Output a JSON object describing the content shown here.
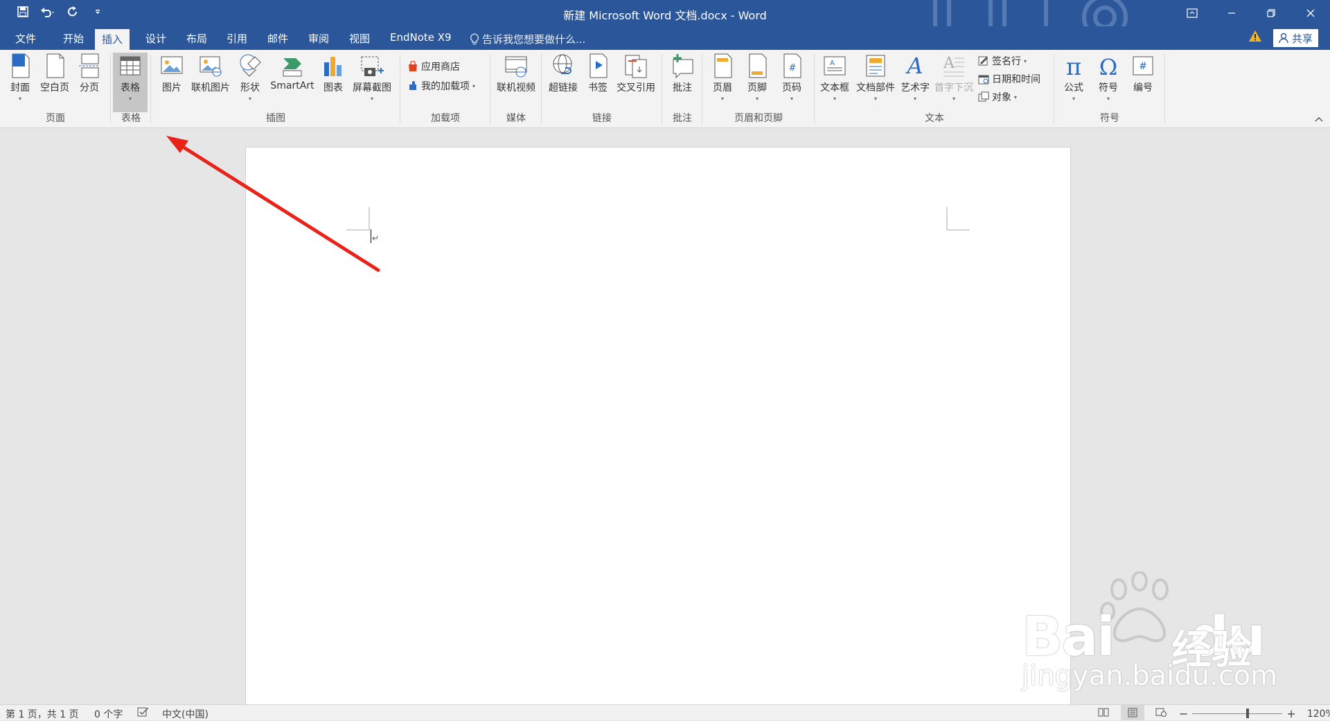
{
  "titlebar": {
    "title": "新建 Microsoft Word 文档.docx - Word",
    "qat_icons": [
      "save-icon",
      "undo-icon",
      "redo-icon",
      "customize-qat-icon"
    ],
    "window_icons": [
      "ribbon-display-options-icon",
      "minimize-icon",
      "restore-icon",
      "close-icon"
    ]
  },
  "tabs": [
    "文件",
    "开始",
    "插入",
    "设计",
    "布局",
    "引用",
    "邮件",
    "审阅",
    "视图",
    "EndNote X9"
  ],
  "active_tab": "插入",
  "tellme": {
    "placeholder": "告诉我您想要做什么..."
  },
  "share_label": "共享",
  "ribbon": {
    "pages": {
      "label": "页面",
      "cover": "封面",
      "blank": "空白页",
      "break": "分页"
    },
    "tables": {
      "label": "表格",
      "table": "表格"
    },
    "illustrations": {
      "label": "插图",
      "picture": "图片",
      "online_picture": "联机图片",
      "shapes": "形状",
      "smartart": "SmartArt",
      "chart": "图表",
      "screenshot": "屏幕截图"
    },
    "addins": {
      "label": "加载项",
      "store": "应用商店",
      "my_addins": "我的加载项"
    },
    "media": {
      "label": "媒体",
      "online_video": "联机视频"
    },
    "links": {
      "label": "链接",
      "hyperlink": "超链接",
      "bookmark": "书签",
      "cross_ref": "交叉引用"
    },
    "comments": {
      "label": "批注",
      "comment": "批注"
    },
    "header_footer": {
      "label": "页眉和页脚",
      "header": "页眉",
      "footer": "页脚",
      "page_number": "页码"
    },
    "text": {
      "label": "文本",
      "textbox": "文本框",
      "quick_parts": "文档部件",
      "wordart": "艺术字",
      "dropcap": "首字下沉",
      "signature": "签名行",
      "datetime": "日期和时间",
      "object": "对象"
    },
    "symbols": {
      "label": "符号",
      "equation": "公式",
      "symbol": "符号",
      "numbering": "编号"
    }
  },
  "document": {
    "paragraph_mark": "↵"
  },
  "statusbar": {
    "page": "第 1 页，共 1 页",
    "words": "0 个字",
    "language": "中文(中国)",
    "zoom": "120%",
    "zoom_minus": "−",
    "zoom_plus": "+"
  },
  "watermark": {
    "brand": "Bai",
    "brand2": "du",
    "cn": "经验",
    "url": "jingyan.baidu.com"
  },
  "colors": {
    "accent": "#2b579a",
    "ribbon_bg": "#f3f3f3",
    "arrow": "#e8231a"
  }
}
